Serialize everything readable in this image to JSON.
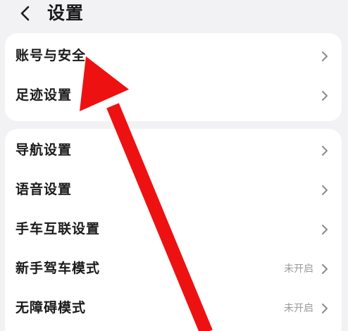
{
  "header": {
    "title": "设置",
    "back_icon": "chevron-left-icon"
  },
  "group1": {
    "items": [
      {
        "label": "账号与安全",
        "icon": "chevron-right-icon"
      },
      {
        "label": "足迹设置",
        "icon": "chevron-right-icon"
      }
    ]
  },
  "group2": {
    "items": [
      {
        "label": "导航设置",
        "icon": "chevron-right-icon"
      },
      {
        "label": "语音设置",
        "icon": "chevron-right-icon"
      },
      {
        "label": "手车互联设置",
        "icon": "chevron-right-icon"
      },
      {
        "label": "新手驾车模式",
        "status": "未开启",
        "icon": "chevron-right-icon"
      },
      {
        "label": "无障碍模式",
        "status": "未开启",
        "icon": "chevron-right-icon"
      }
    ]
  },
  "annotation": {
    "arrow_icon": "red-arrow-icon",
    "color": "#ee1111"
  },
  "colors": {
    "background": "#f2f2f4",
    "card": "#ffffff",
    "text": "#1a1a1a",
    "status_text": "#9a9a9a",
    "chevron": "#8a8a8a"
  }
}
